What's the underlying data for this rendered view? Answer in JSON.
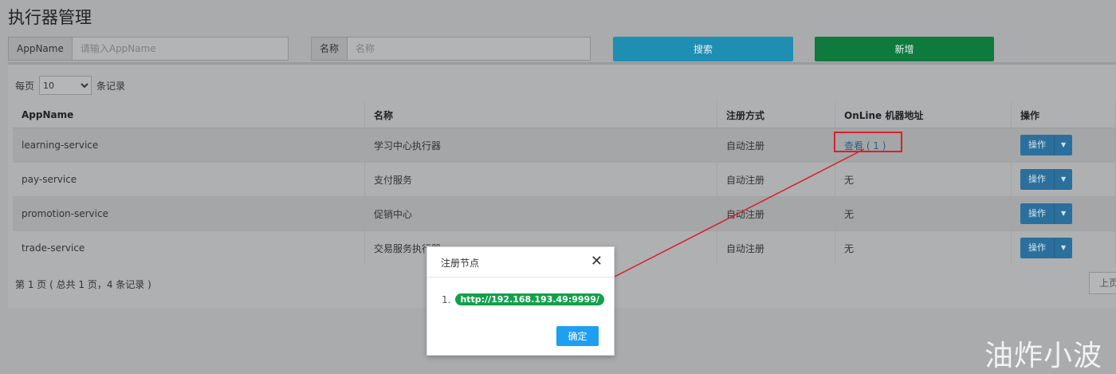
{
  "page_title": "执行器管理",
  "search": {
    "appname_label": "AppName",
    "appname_placeholder": "请输入AppName",
    "name_label": "名称",
    "name_placeholder": "名称",
    "search_button": "搜索",
    "add_button": "新增"
  },
  "pagination": {
    "per_page_prefix": "每页",
    "per_page_value": "10",
    "per_page_suffix": "条记录",
    "summary": "第 1 页 ( 总共 1 页，4 条记录 )",
    "prev_button": "上页"
  },
  "table": {
    "headers": [
      "AppName",
      "名称",
      "注册方式",
      "OnLine 机器地址",
      "操作"
    ],
    "rows": [
      {
        "appname": "learning-service",
        "name": "学习中心执行器",
        "register": "自动注册",
        "online": "查看 ( 1 )",
        "op": "操作"
      },
      {
        "appname": "pay-service",
        "name": "支付服务",
        "register": "自动注册",
        "online": "无",
        "op": "操作"
      },
      {
        "appname": "promotion-service",
        "name": "促销中心",
        "register": "自动注册",
        "online": "无",
        "op": "操作"
      },
      {
        "appname": "trade-service",
        "name": "交易服务执行器",
        "register": "自动注册",
        "online": "无",
        "op": "操作"
      }
    ]
  },
  "modal": {
    "title": "注册节点",
    "item_index": "1.",
    "address": "http://192.168.193.49:9999/",
    "ok_button": "确定"
  },
  "watermark": "油炸小波",
  "colors": {
    "search_button": "#1f8eb3",
    "add_button": "#0f7a3d",
    "op_button": "#2b6f9c",
    "annotation_red": "#d9202a",
    "address_badge": "#12a14b",
    "ok_button": "#1e9ff2"
  }
}
